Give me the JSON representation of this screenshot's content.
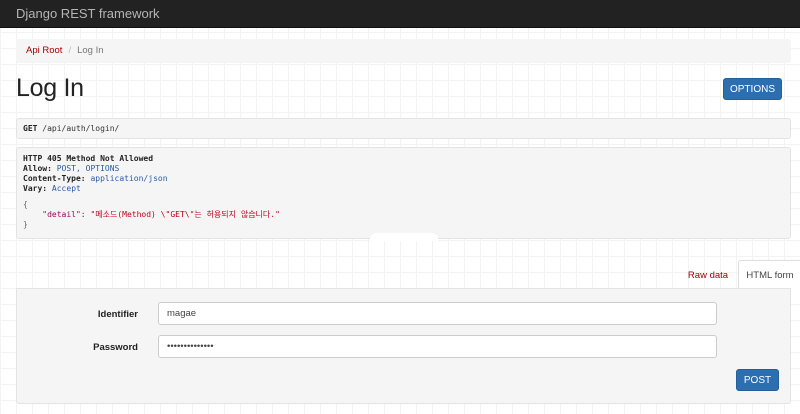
{
  "navbar": {
    "brand": "Django REST framework"
  },
  "breadcrumb": {
    "root": "Api Root",
    "separator": "/",
    "current": "Log In"
  },
  "page": {
    "title": "Log In",
    "options_label": "OPTIONS"
  },
  "request": {
    "method": "GET",
    "path": "/api/auth/login/"
  },
  "response": {
    "status": "HTTP 405 Method Not Allowed",
    "headers": [
      {
        "name": "Allow:",
        "value": "POST, OPTIONS"
      },
      {
        "name": "Content-Type:",
        "value": "application/json"
      },
      {
        "name": "Vary:",
        "value": "Accept"
      }
    ],
    "body_open": "{",
    "body_key": "\"detail\"",
    "body_colon": ": ",
    "body_value": "\"메소드(Method) \\\"GET\\\"는 허용되지 않습니다.\"",
    "body_close": "}"
  },
  "tabs": {
    "raw": "Raw data",
    "html": "HTML form"
  },
  "form": {
    "identifier_label": "Identifier",
    "identifier_value": "magae",
    "password_label": "Password",
    "password_value": "••••••••••••••",
    "submit_label": "POST"
  },
  "colors": {
    "navbar": "#222222",
    "link": "#a30000",
    "primary": "#2c6fb0"
  }
}
